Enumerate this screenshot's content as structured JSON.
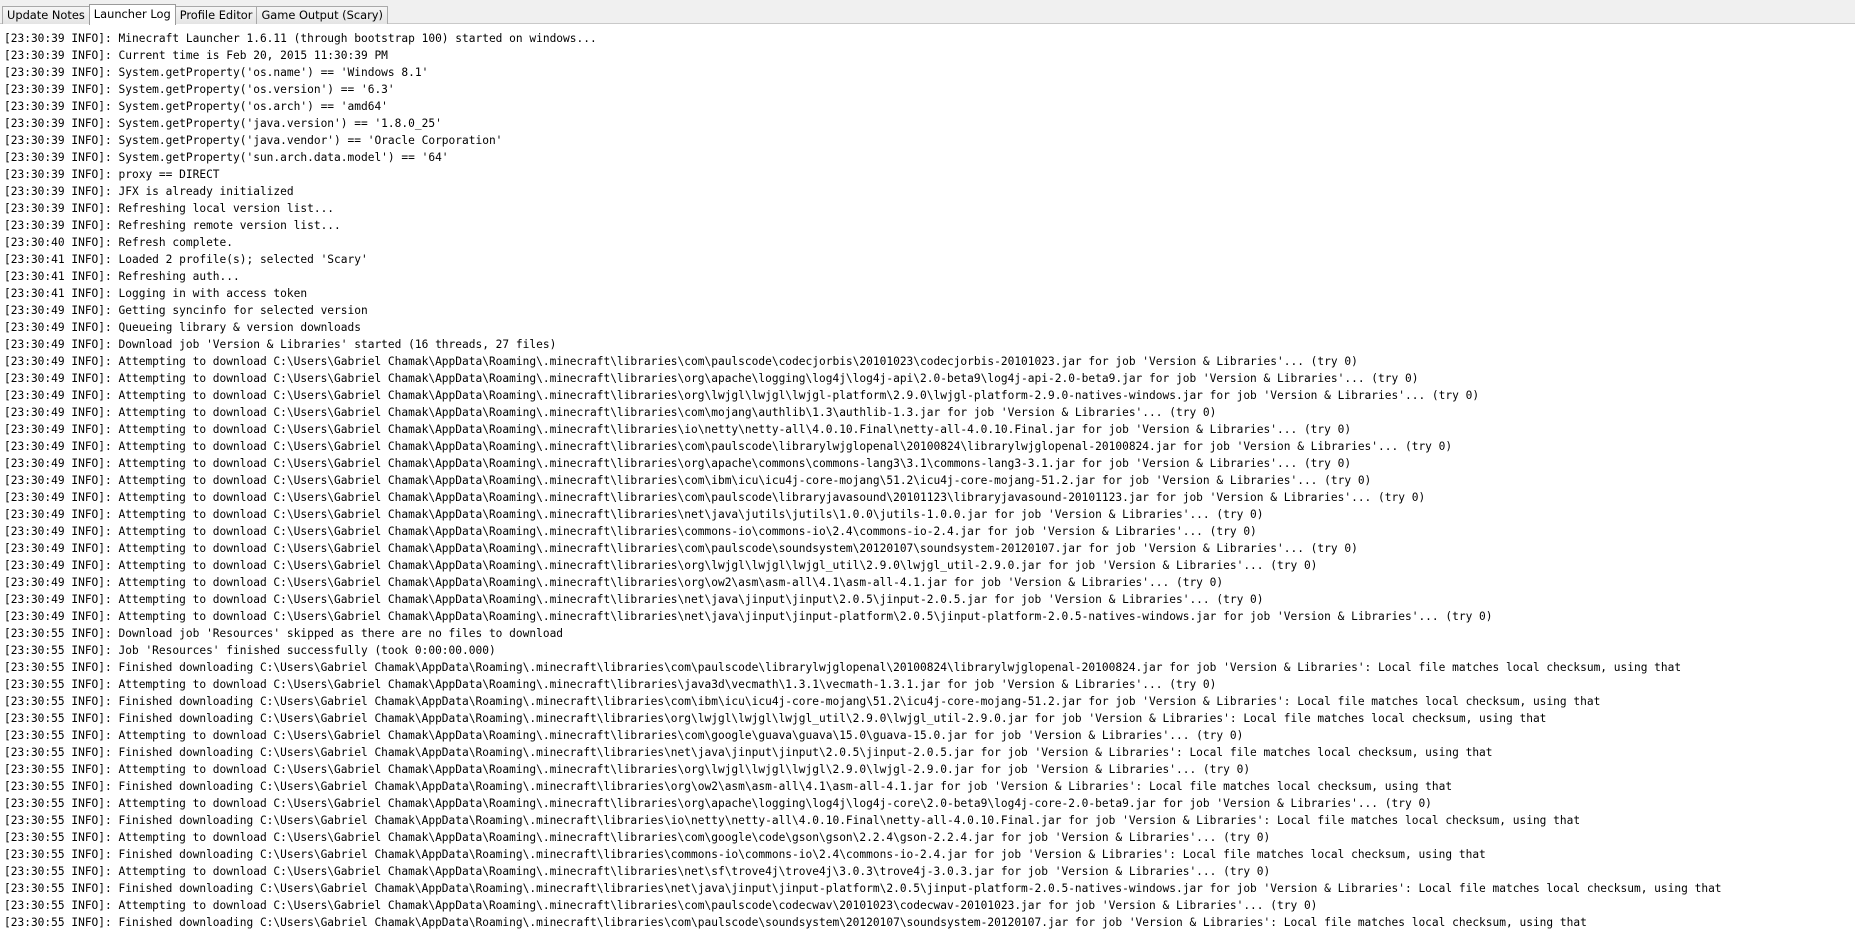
{
  "tabs": [
    {
      "label": "Update Notes",
      "active": false
    },
    {
      "label": "Launcher Log",
      "active": true
    },
    {
      "label": "Profile Editor",
      "active": false
    },
    {
      "label": "Game Output (Scary)",
      "active": false
    }
  ],
  "log_lines": [
    "[23:30:39 INFO]: Minecraft Launcher 1.6.11 (through bootstrap 100) started on windows...",
    "[23:30:39 INFO]: Current time is Feb 20, 2015 11:30:39 PM",
    "[23:30:39 INFO]: System.getProperty('os.name') == 'Windows 8.1'",
    "[23:30:39 INFO]: System.getProperty('os.version') == '6.3'",
    "[23:30:39 INFO]: System.getProperty('os.arch') == 'amd64'",
    "[23:30:39 INFO]: System.getProperty('java.version') == '1.8.0_25'",
    "[23:30:39 INFO]: System.getProperty('java.vendor') == 'Oracle Corporation'",
    "[23:30:39 INFO]: System.getProperty('sun.arch.data.model') == '64'",
    "[23:30:39 INFO]: proxy == DIRECT",
    "[23:30:39 INFO]: JFX is already initialized",
    "[23:30:39 INFO]: Refreshing local version list...",
    "[23:30:39 INFO]: Refreshing remote version list...",
    "[23:30:40 INFO]: Refresh complete.",
    "[23:30:41 INFO]: Loaded 2 profile(s); selected 'Scary'",
    "[23:30:41 INFO]: Refreshing auth...",
    "[23:30:41 INFO]: Logging in with access token",
    "[23:30:49 INFO]: Getting syncinfo for selected version",
    "[23:30:49 INFO]: Queueing library & version downloads",
    "[23:30:49 INFO]: Download job 'Version & Libraries' started (16 threads, 27 files)",
    "[23:30:49 INFO]: Attempting to download C:\\Users\\Gabriel Chamak\\AppData\\Roaming\\.minecraft\\libraries\\com\\paulscode\\codecjorbis\\20101023\\codecjorbis-20101023.jar for job 'Version & Libraries'... (try 0)",
    "[23:30:49 INFO]: Attempting to download C:\\Users\\Gabriel Chamak\\AppData\\Roaming\\.minecraft\\libraries\\org\\apache\\logging\\log4j\\log4j-api\\2.0-beta9\\log4j-api-2.0-beta9.jar for job 'Version & Libraries'... (try 0)",
    "[23:30:49 INFO]: Attempting to download C:\\Users\\Gabriel Chamak\\AppData\\Roaming\\.minecraft\\libraries\\org\\lwjgl\\lwjgl\\lwjgl-platform\\2.9.0\\lwjgl-platform-2.9.0-natives-windows.jar for job 'Version & Libraries'... (try 0)",
    "[23:30:49 INFO]: Attempting to download C:\\Users\\Gabriel Chamak\\AppData\\Roaming\\.minecraft\\libraries\\com\\mojang\\authlib\\1.3\\authlib-1.3.jar for job 'Version & Libraries'... (try 0)",
    "[23:30:49 INFO]: Attempting to download C:\\Users\\Gabriel Chamak\\AppData\\Roaming\\.minecraft\\libraries\\io\\netty\\netty-all\\4.0.10.Final\\netty-all-4.0.10.Final.jar for job 'Version & Libraries'... (try 0)",
    "[23:30:49 INFO]: Attempting to download C:\\Users\\Gabriel Chamak\\AppData\\Roaming\\.minecraft\\libraries\\com\\paulscode\\librarylwjglopenal\\20100824\\librarylwjglopenal-20100824.jar for job 'Version & Libraries'... (try 0)",
    "[23:30:49 INFO]: Attempting to download C:\\Users\\Gabriel Chamak\\AppData\\Roaming\\.minecraft\\libraries\\org\\apache\\commons\\commons-lang3\\3.1\\commons-lang3-3.1.jar for job 'Version & Libraries'... (try 0)",
    "[23:30:49 INFO]: Attempting to download C:\\Users\\Gabriel Chamak\\AppData\\Roaming\\.minecraft\\libraries\\com\\ibm\\icu\\icu4j-core-mojang\\51.2\\icu4j-core-mojang-51.2.jar for job 'Version & Libraries'... (try 0)",
    "[23:30:49 INFO]: Attempting to download C:\\Users\\Gabriel Chamak\\AppData\\Roaming\\.minecraft\\libraries\\com\\paulscode\\libraryjavasound\\20101123\\libraryjavasound-20101123.jar for job 'Version & Libraries'... (try 0)",
    "[23:30:49 INFO]: Attempting to download C:\\Users\\Gabriel Chamak\\AppData\\Roaming\\.minecraft\\libraries\\net\\java\\jutils\\jutils\\1.0.0\\jutils-1.0.0.jar for job 'Version & Libraries'... (try 0)",
    "[23:30:49 INFO]: Attempting to download C:\\Users\\Gabriel Chamak\\AppData\\Roaming\\.minecraft\\libraries\\commons-io\\commons-io\\2.4\\commons-io-2.4.jar for job 'Version & Libraries'... (try 0)",
    "[23:30:49 INFO]: Attempting to download C:\\Users\\Gabriel Chamak\\AppData\\Roaming\\.minecraft\\libraries\\com\\paulscode\\soundsystem\\20120107\\soundsystem-20120107.jar for job 'Version & Libraries'... (try 0)",
    "[23:30:49 INFO]: Attempting to download C:\\Users\\Gabriel Chamak\\AppData\\Roaming\\.minecraft\\libraries\\org\\lwjgl\\lwjgl\\lwjgl_util\\2.9.0\\lwjgl_util-2.9.0.jar for job 'Version & Libraries'... (try 0)",
    "[23:30:49 INFO]: Attempting to download C:\\Users\\Gabriel Chamak\\AppData\\Roaming\\.minecraft\\libraries\\org\\ow2\\asm\\asm-all\\4.1\\asm-all-4.1.jar for job 'Version & Libraries'... (try 0)",
    "[23:30:49 INFO]: Attempting to download C:\\Users\\Gabriel Chamak\\AppData\\Roaming\\.minecraft\\libraries\\net\\java\\jinput\\jinput\\2.0.5\\jinput-2.0.5.jar for job 'Version & Libraries'... (try 0)",
    "[23:30:49 INFO]: Attempting to download C:\\Users\\Gabriel Chamak\\AppData\\Roaming\\.minecraft\\libraries\\net\\java\\jinput\\jinput-platform\\2.0.5\\jinput-platform-2.0.5-natives-windows.jar for job 'Version & Libraries'... (try 0)",
    "[23:30:55 INFO]: Download job 'Resources' skipped as there are no files to download",
    "[23:30:55 INFO]: Job 'Resources' finished successfully (took 0:00:00.000)",
    "[23:30:55 INFO]: Finished downloading C:\\Users\\Gabriel Chamak\\AppData\\Roaming\\.minecraft\\libraries\\com\\paulscode\\librarylwjglopenal\\20100824\\librarylwjglopenal-20100824.jar for job 'Version & Libraries': Local file matches local checksum, using that",
    "[23:30:55 INFO]: Attempting to download C:\\Users\\Gabriel Chamak\\AppData\\Roaming\\.minecraft\\libraries\\java3d\\vecmath\\1.3.1\\vecmath-1.3.1.jar for job 'Version & Libraries'... (try 0)",
    "[23:30:55 INFO]: Finished downloading C:\\Users\\Gabriel Chamak\\AppData\\Roaming\\.minecraft\\libraries\\com\\ibm\\icu\\icu4j-core-mojang\\51.2\\icu4j-core-mojang-51.2.jar for job 'Version & Libraries': Local file matches local checksum, using that",
    "[23:30:55 INFO]: Finished downloading C:\\Users\\Gabriel Chamak\\AppData\\Roaming\\.minecraft\\libraries\\org\\lwjgl\\lwjgl\\lwjgl_util\\2.9.0\\lwjgl_util-2.9.0.jar for job 'Version & Libraries': Local file matches local checksum, using that",
    "[23:30:55 INFO]: Attempting to download C:\\Users\\Gabriel Chamak\\AppData\\Roaming\\.minecraft\\libraries\\com\\google\\guava\\guava\\15.0\\guava-15.0.jar for job 'Version & Libraries'... (try 0)",
    "[23:30:55 INFO]: Finished downloading C:\\Users\\Gabriel Chamak\\AppData\\Roaming\\.minecraft\\libraries\\net\\java\\jinput\\jinput\\2.0.5\\jinput-2.0.5.jar for job 'Version & Libraries': Local file matches local checksum, using that",
    "[23:30:55 INFO]: Attempting to download C:\\Users\\Gabriel Chamak\\AppData\\Roaming\\.minecraft\\libraries\\org\\lwjgl\\lwjgl\\lwjgl\\2.9.0\\lwjgl-2.9.0.jar for job 'Version & Libraries'... (try 0)",
    "[23:30:55 INFO]: Finished downloading C:\\Users\\Gabriel Chamak\\AppData\\Roaming\\.minecraft\\libraries\\org\\ow2\\asm\\asm-all\\4.1\\asm-all-4.1.jar for job 'Version & Libraries': Local file matches local checksum, using that",
    "[23:30:55 INFO]: Attempting to download C:\\Users\\Gabriel Chamak\\AppData\\Roaming\\.minecraft\\libraries\\org\\apache\\logging\\log4j\\log4j-core\\2.0-beta9\\log4j-core-2.0-beta9.jar for job 'Version & Libraries'... (try 0)",
    "[23:30:55 INFO]: Finished downloading C:\\Users\\Gabriel Chamak\\AppData\\Roaming\\.minecraft\\libraries\\io\\netty\\netty-all\\4.0.10.Final\\netty-all-4.0.10.Final.jar for job 'Version & Libraries': Local file matches local checksum, using that",
    "[23:30:55 INFO]: Attempting to download C:\\Users\\Gabriel Chamak\\AppData\\Roaming\\.minecraft\\libraries\\com\\google\\code\\gson\\gson\\2.2.4\\gson-2.2.4.jar for job 'Version & Libraries'... (try 0)",
    "[23:30:55 INFO]: Finished downloading C:\\Users\\Gabriel Chamak\\AppData\\Roaming\\.minecraft\\libraries\\commons-io\\commons-io\\2.4\\commons-io-2.4.jar for job 'Version & Libraries': Local file matches local checksum, using that",
    "[23:30:55 INFO]: Attempting to download C:\\Users\\Gabriel Chamak\\AppData\\Roaming\\.minecraft\\libraries\\net\\sf\\trove4j\\trove4j\\3.0.3\\trove4j-3.0.3.jar for job 'Version & Libraries'... (try 0)",
    "[23:30:55 INFO]: Finished downloading C:\\Users\\Gabriel Chamak\\AppData\\Roaming\\.minecraft\\libraries\\net\\java\\jinput\\jinput-platform\\2.0.5\\jinput-platform-2.0.5-natives-windows.jar for job 'Version & Libraries': Local file matches local checksum, using that",
    "[23:30:55 INFO]: Attempting to download C:\\Users\\Gabriel Chamak\\AppData\\Roaming\\.minecraft\\libraries\\com\\paulscode\\codecwav\\20101023\\codecwav-20101023.jar for job 'Version & Libraries'... (try 0)",
    "[23:30:55 INFO]: Finished downloading C:\\Users\\Gabriel Chamak\\AppData\\Roaming\\.minecraft\\libraries\\com\\paulscode\\soundsystem\\20120107\\soundsystem-20120107.jar for job 'Version & Libraries': Local file matches local checksum, using that"
  ]
}
